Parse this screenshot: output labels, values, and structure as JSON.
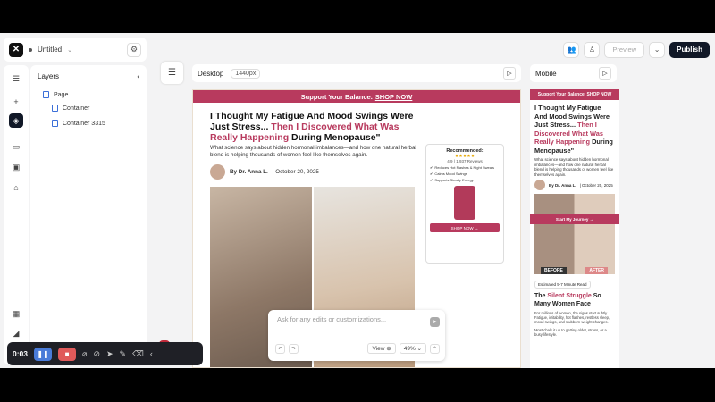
{
  "app": {
    "project_name": "Untitled",
    "preview_label": "Preview",
    "publish_label": "Publish"
  },
  "layers": {
    "title": "Layers",
    "items": [
      "Page",
      "Container",
      "Container 3315"
    ]
  },
  "desktop": {
    "label": "Desktop",
    "width_label": "1440px"
  },
  "mobile": {
    "label": "Mobile"
  },
  "page": {
    "banner_text": "Support Your Balance.",
    "banner_link": "SHOP NOW",
    "headline_black": "I Thought My Fatigue And Mood Swings Were Just Stress...",
    "headline_pink": "Then I Discovered What Was Really Happening",
    "headline_end": "During Menopause\"",
    "subhead": "What science says about hidden hormonal imbalances—and how one natural herbal blend is helping thousands of women feel like themselves again.",
    "author": "By Dr. Anna L.",
    "date": "| October 20, 2025",
    "card": {
      "title": "Recommended:",
      "stars": "★★★★★",
      "reviews": "4.9 | 1,937 Reviews",
      "features": [
        "Reduces Hot Flashes & Night Sweats",
        "Calms Mood Swings",
        "Supports Steady Energy"
      ],
      "button": "SHOP NOW →"
    }
  },
  "mobile_page": {
    "banner": "Support Your Balance. SHOP NOW",
    "headline_black": "I Thought My Fatigue And Mood Swings Were Just Stress...",
    "headline_pink": "Then I Discovered What Was Really Happening",
    "headline_end": "During Menopause\"",
    "subhead": "What science says about hidden hormonal imbalances—and how one natural herbal blend is helping thousands of women feel like themselves again.",
    "author": "By Dr. Anna L.",
    "date": "| October 20, 2025",
    "cta": "Start My Journey →",
    "before": "BEFORE",
    "after": "AFTER",
    "estimate": "Estimated 5-7 Minute Read",
    "h2_black": "The",
    "h2_pink": "Silent Struggle",
    "h2_end": "So Many Women Face",
    "para1": "For millions of women, the signs start subtly. Fatigue, irritability, hot flashes, restless sleep, mood swings, and stubborn weight changes.",
    "para2": "Most chalk it up to getting older, stress, or a busy lifestyle."
  },
  "chat": {
    "placeholder": "Ask for any edits or customizations...",
    "view_label": "View",
    "zoom": "49%"
  },
  "recorder": {
    "time": "0:03"
  }
}
